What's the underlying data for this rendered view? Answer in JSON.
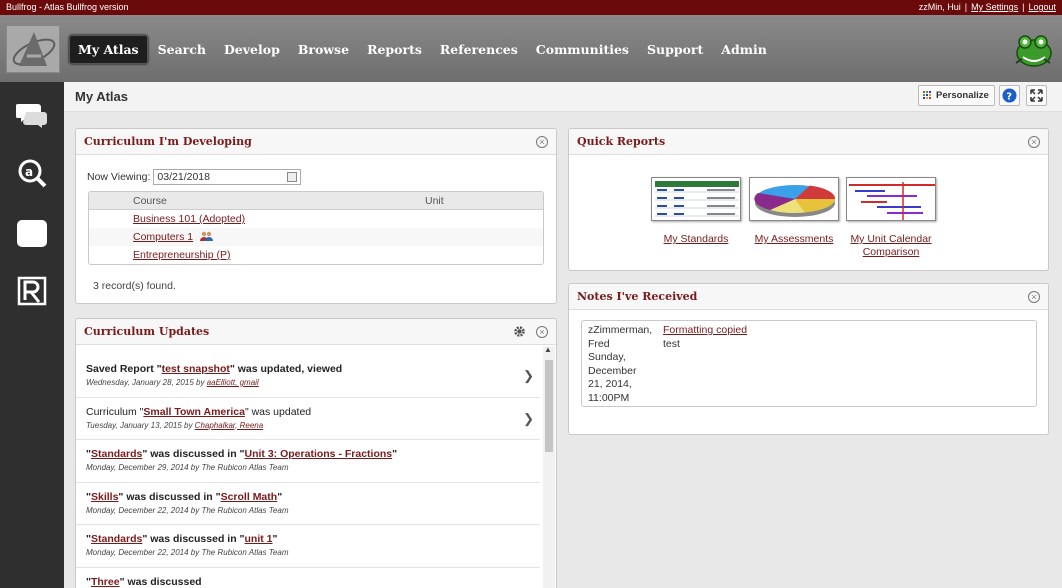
{
  "topbar": {
    "left": "Bullfrog - Atlas Bullfrog version",
    "user": "zzMin, Hui",
    "sep": "|",
    "settings": "My Settings",
    "logout": "Logout"
  },
  "nav": {
    "items": [
      "My Atlas",
      "Search",
      "Develop",
      "Browse",
      "Reports",
      "References",
      "Communities",
      "Support",
      "Admin"
    ],
    "active": "My Atlas"
  },
  "page": {
    "title": "My Atlas",
    "personalize_label": "Personalize"
  },
  "curriculum": {
    "title": "Curriculum I'm Developing",
    "now_viewing_label": "Now Viewing:",
    "date": "03/21/2018",
    "columns": [
      "Course",
      "Unit"
    ],
    "rows": [
      {
        "course": "Business 101 (Adopted)",
        "unit": ""
      },
      {
        "course": "Computers 1",
        "unit": ""
      },
      {
        "course": "Entrepreneurship (P)",
        "unit": ""
      }
    ],
    "records": "3 record(s) found."
  },
  "updates": {
    "title": "Curriculum Updates",
    "items": [
      {
        "pre": "Saved Report \"",
        "link": "test snapshot",
        "post": "\" was updated, viewed",
        "date": "Wednesday, January 28, 2015 by ",
        "by_link": "aaElliott, gmail",
        "by_plain": ""
      },
      {
        "pre": "Curriculum \"",
        "link": "Small Town America",
        "post": "\" was updated",
        "date": "Tuesday, January 13, 2015 by ",
        "by_link": "Chaphalkar, Reena",
        "by_plain": ""
      },
      {
        "pre": "\"",
        "link": "Standards",
        "mid": "\" was discussed in \"",
        "link2": "Unit 3: Operations - Fractions",
        "post": "\"",
        "date": "Monday, December 29, 2014 by The Rubicon Atlas Team"
      },
      {
        "pre": "\"",
        "link": "Skills",
        "mid": "\" was discussed in \"",
        "link2": "Scroll Math",
        "post": "\"",
        "date": "Monday, December 22, 2014 by The Rubicon Atlas Team"
      },
      {
        "pre": "\"",
        "link": "Standards",
        "mid": "\" was discussed in \"",
        "link2": "unit 1",
        "post": "\"",
        "date": "Monday, December 22, 2014 by The Rubicon Atlas Team"
      },
      {
        "pre": "\"",
        "link": "Three",
        "post": "\" was discussed"
      }
    ]
  },
  "quick_reports": {
    "title": "Quick Reports",
    "items": [
      {
        "label": "My Standards",
        "icon": "standards-report-thumbnail"
      },
      {
        "label": "My Assessments",
        "icon": "assessments-pie-thumbnail"
      },
      {
        "label": "My Unit Calendar",
        "label2": "Comparison",
        "icon": "calendar-gantt-thumbnail"
      }
    ]
  },
  "notes": {
    "title": "Notes I've Received",
    "from_lines": [
      "zZimmerman,",
      "Fred",
      "Sunday,",
      "December",
      "21, 2014,",
      "11:00PM"
    ],
    "subject": "Formatting copied",
    "body": "test"
  },
  "colors": {
    "brand": "#6b0a0a",
    "link": "#7a1a1a",
    "nav_bg": "#7b7b7b",
    "rail_bg": "#2f2f2f"
  }
}
